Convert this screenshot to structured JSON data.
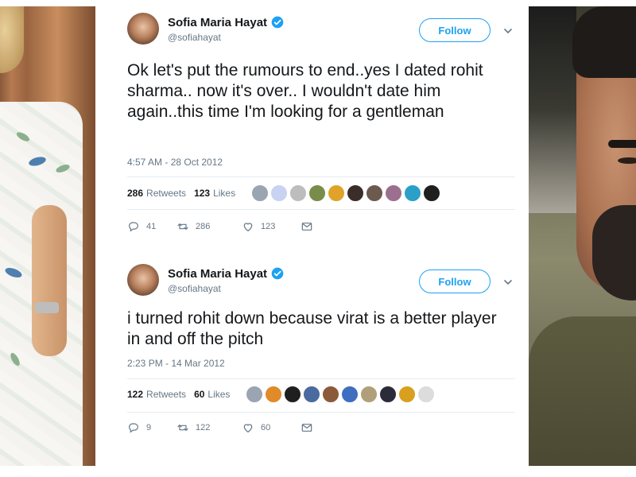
{
  "tweets": [
    {
      "name": "Sofia Maria Hayat",
      "handle": "@sofiahayat",
      "follow_label": "Follow",
      "text": "Ok let's put the rumours to end..yes I dated rohit sharma.. now it's over.. I wouldn't date him again..this time I'm looking for a gentleman",
      "timestamp": "4:57 AM - 28 Oct 2012",
      "retweets_count": "286",
      "retweets_label": "Retweets",
      "likes_count": "123",
      "likes_label": "Likes",
      "replies": "41",
      "retweets_action": "286",
      "likes_action": "123"
    },
    {
      "name": "Sofia Maria Hayat",
      "handle": "@sofiahayat",
      "follow_label": "Follow",
      "text": "i turned rohit down because virat is a better player in and off the pitch",
      "timestamp": "2:23 PM - 14 Mar 2012",
      "retweets_count": "122",
      "retweets_label": "Retweets",
      "likes_count": "60",
      "likes_label": "Likes",
      "replies": "9",
      "retweets_action": "122",
      "likes_action": "60"
    }
  ],
  "colors": {
    "accent": "#1da1f2",
    "secondary_text": "#657786",
    "primary_text": "#14171a",
    "divider": "#e6ecf0"
  },
  "icons": [
    "verified-badge-icon",
    "chevron-down-icon",
    "reply-icon",
    "retweet-icon",
    "like-heart-icon",
    "direct-message-icon"
  ]
}
